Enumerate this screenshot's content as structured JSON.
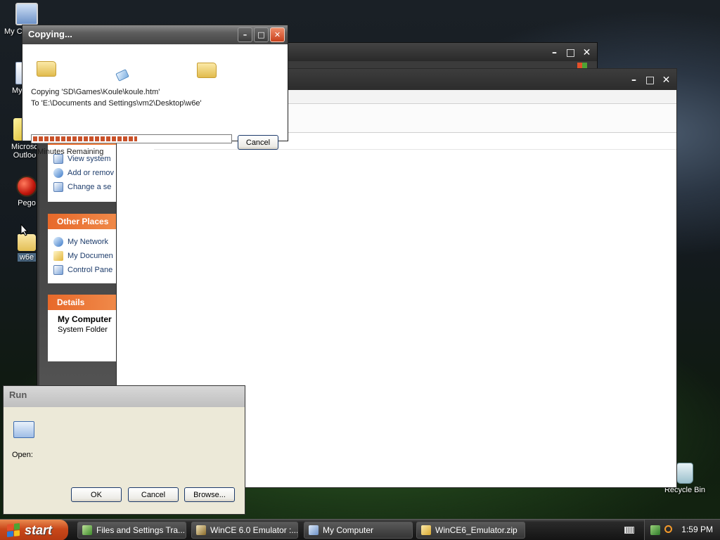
{
  "desktop": {
    "icons": [
      {
        "label": "My C",
        "icon": "computer-icon"
      },
      {
        "label": "My",
        "icon": "documents-icon"
      },
      {
        "label": "Microsc\nOutloo",
        "icon": "outlook-icon"
      },
      {
        "label": "Pego",
        "icon": "pego-icon"
      },
      {
        "label": "w6e",
        "icon": "folder-icon"
      },
      {
        "label": "Recycle Bin",
        "icon": "recycle-bin-icon"
      }
    ]
  },
  "copy_dialog": {
    "title": "Copying...",
    "from": "Copying 'SD\\Games\\Koule\\koule.htm'",
    "to": "To 'E:\\Documents and Settings\\vm2\\Desktop\\w6e'",
    "progress": 0.53,
    "remaining": "2 Minutes Remaining",
    "cancel": "Cancel"
  },
  "explorer_back": {
    "system_tasks": {
      "items": [
        "View system",
        "Add or remov",
        "Change a se"
      ]
    },
    "other_places": {
      "title": "Other Places",
      "items": [
        "My Network",
        "My Documen",
        "Control Pane"
      ]
    },
    "details": {
      "title": "Details",
      "name": "My Computer",
      "type": "System Folder"
    }
  },
  "run_dialog": {
    "title": "Run",
    "open_label": "Open:",
    "ok": "OK",
    "cancel": "Cancel",
    "browse": "Browse..."
  },
  "taskbar": {
    "start": "start",
    "tasks": [
      {
        "label": "Files and Settings Tra...",
        "icon": "files-settings-icon"
      },
      {
        "label": "WinCE 6.0 Emulator :...",
        "icon": "emulator-icon"
      },
      {
        "label": "My Computer",
        "icon": "computer-icon"
      },
      {
        "label": "WinCE6_Emulator.zip",
        "icon": "zip-folder-icon"
      }
    ],
    "clock": "1:59 PM"
  },
  "colors": {
    "task_pane_header": "#e7692a",
    "start_button": "#c9481a",
    "progress_fill": "#c9522a"
  }
}
